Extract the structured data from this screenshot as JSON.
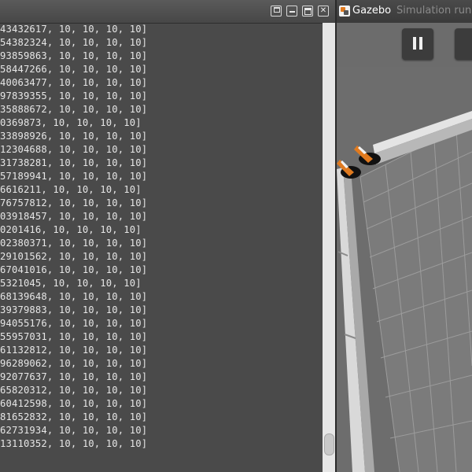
{
  "terminal": {
    "lines": [
      "43432617, 10, 10, 10, 10]",
      "54382324, 10, 10, 10, 10]",
      "93859863, 10, 10, 10, 10]",
      "58447266, 10, 10, 10, 10]",
      "40063477, 10, 10, 10, 10]",
      "97839355, 10, 10, 10, 10]",
      "35888672, 10, 10, 10, 10]",
      "0369873, 10, 10, 10, 10]",
      "33898926, 10, 10, 10, 10]",
      "12304688, 10, 10, 10, 10]",
      "31738281, 10, 10, 10, 10]",
      "57189941, 10, 10, 10, 10]",
      "6616211, 10, 10, 10, 10]",
      "76757812, 10, 10, 10, 10]",
      "03918457, 10, 10, 10, 10]",
      "0201416, 10, 10, 10, 10]",
      "02380371, 10, 10, 10, 10]",
      "29101562, 10, 10, 10, 10]",
      "67041016, 10, 10, 10, 10]",
      "5321045, 10, 10, 10, 10]",
      "68139648, 10, 10, 10, 10]",
      "39379883, 10, 10, 10, 10]",
      "94055176, 10, 10, 10, 10]",
      "55957031, 10, 10, 10, 10]",
      "61132812, 10, 10, 10, 10]",
      "96289062, 10, 10, 10, 10]",
      "92077637, 10, 10, 10, 10]",
      "65820312, 10, 10, 10, 10]",
      "60412598, 10, 10, 10, 10]",
      "81652832, 10, 10, 10, 10]",
      "62731934, 10, 10, 10, 10]",
      "13110352, 10, 10, 10, 10]"
    ],
    "window_buttons": [
      "restore-icon",
      "minimize-icon",
      "maximize-icon",
      "close-icon"
    ]
  },
  "gazebo": {
    "title": "Gazebo",
    "subtitle": "Simulation runn",
    "toolbar": {
      "pause_icon": "pause-icon",
      "next_icon": "step-icon"
    },
    "scene": {
      "floor_color": "#7a7a7a",
      "grid_color": "#9a9a9a",
      "cone_color": "#e07a1f"
    }
  }
}
